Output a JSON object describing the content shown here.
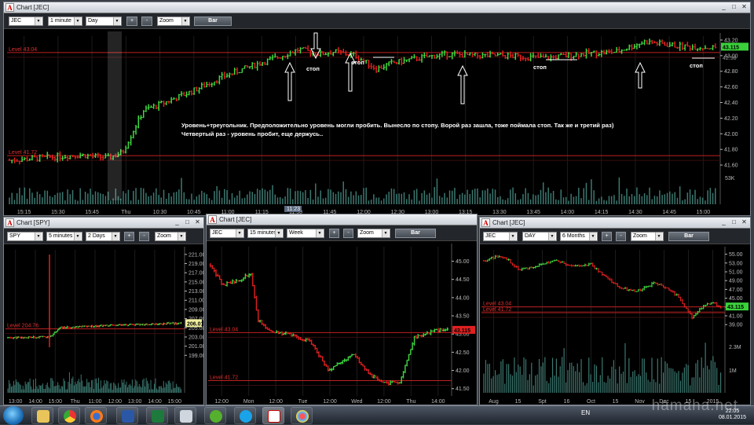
{
  "colors": {
    "up": "#40d840",
    "down": "#e02020",
    "level": "#c02020",
    "axis": "#bbbbbb",
    "volume": "#3c7870"
  },
  "main": {
    "title": "Chart [JEC]",
    "symbol": "JEC",
    "interval": "1 minute",
    "period": "Day",
    "zoom": "Zoom",
    "bar": "Bar",
    "plus": "+",
    "minus": "-",
    "level_top": "Level 43.04",
    "level_bottom": "Level 41.72",
    "last_price": "43.115",
    "ref_price": "42.98",
    "volume_label": "53K",
    "cursor_time": "11:23",
    "annotation_line1": "Уровень+треугольник. Предположительно уровень могли пробить. Вынесло по стопу. Ворой раз зашла, тоже поймала стоп. Так же и третий раз)",
    "annotation_line2": "Четвертый раз - уровень пробит, еще держусь..",
    "stop_label": "стоп"
  },
  "spy": {
    "title": "Chart [SPY]",
    "symbol": "SPY",
    "interval": "5 minutes",
    "period": "2 Days",
    "zoom": "Zoom",
    "bar": "Bar",
    "plus": "+",
    "minus": "-",
    "level": "Level 204.76",
    "last_price": "206.01"
  },
  "jec15": {
    "title": "Chart [JEC]",
    "symbol": "JEC",
    "interval": "15 minutes",
    "period": "Week",
    "zoom": "Zoom",
    "bar": "Bar",
    "plus": "+",
    "minus": "-",
    "level_top": "Level 43.04",
    "level_bottom": "Level 41.72",
    "last_price": "43.115"
  },
  "jecday": {
    "title": "Chart [JEC]",
    "symbol": "JEC",
    "interval": "DAY",
    "period": "6 Months",
    "zoom": "Zoom",
    "bar": "Bar",
    "plus": "+",
    "minus": "-",
    "level_top": "Level 43.04",
    "level_bottom": "Level 41.72",
    "last_price": "43.115"
  },
  "taskbar": {
    "lang": "EN",
    "time": "22:05",
    "date": "08.01.2015"
  },
  "watermark": "hamaha.net",
  "chart_data": [
    {
      "name": "JEC 1 minute",
      "type": "bar",
      "y_ticks": [
        43.2,
        43.0,
        42.8,
        42.6,
        42.4,
        42.2,
        42.0,
        41.8,
        41.6
      ],
      "ylim": [
        41.5,
        43.25
      ],
      "x_labels": [
        "15:15",
        "15:30",
        "15:45",
        "Thu",
        "10:30",
        "10:45",
        "11:00",
        "11:15",
        "11:30",
        "11:45",
        "12:00",
        "12:30",
        "13:00",
        "13:15",
        "13:30",
        "13:45",
        "14:00",
        "14:15",
        "14:30",
        "14:45",
        "15:00"
      ],
      "levels": [
        43.04,
        41.72
      ],
      "anchors": [
        [
          0,
          41.66
        ],
        [
          0.1,
          41.73
        ],
        [
          0.14,
          41.69
        ],
        [
          0.16,
          41.76
        ],
        [
          0.19,
          42.3
        ],
        [
          0.22,
          42.4
        ],
        [
          0.26,
          42.55
        ],
        [
          0.3,
          42.72
        ],
        [
          0.34,
          42.86
        ],
        [
          0.38,
          42.98
        ],
        [
          0.41,
          43.08
        ],
        [
          0.44,
          43.02
        ],
        [
          0.46,
          43.05
        ],
        [
          0.49,
          43.0
        ],
        [
          0.52,
          42.83
        ],
        [
          0.54,
          42.9
        ],
        [
          0.58,
          42.97
        ],
        [
          0.62,
          43.02
        ],
        [
          0.66,
          43.0
        ],
        [
          0.7,
          43.0
        ],
        [
          0.76,
          42.97
        ],
        [
          0.82,
          43.03
        ],
        [
          0.86,
          43.05
        ],
        [
          0.9,
          43.18
        ],
        [
          0.95,
          43.12
        ],
        [
          1,
          43.1
        ]
      ]
    },
    {
      "name": "SPY 5 minutes",
      "type": "bar",
      "y_ticks": [
        221.0,
        219.0,
        217.0,
        215.0,
        213.0,
        211.0,
        209.0,
        207.0,
        205.0,
        203.0,
        201.0,
        199.0
      ],
      "ylim": [
        197,
        222
      ],
      "x_labels": [
        "13:00",
        "14:00",
        "15:00",
        "Thu",
        "11:00",
        "12:00",
        "13:00",
        "14:00",
        "15:00"
      ],
      "levels": [
        204.76
      ],
      "anchors": [
        [
          0,
          202.8
        ],
        [
          0.22,
          203.0
        ],
        [
          0.24,
          202.9
        ],
        [
          0.3,
          205.0
        ],
        [
          0.5,
          205.4
        ],
        [
          0.7,
          205.6
        ],
        [
          0.9,
          205.9
        ],
        [
          1,
          206.0
        ]
      ]
    },
    {
      "name": "JEC 15 minutes",
      "type": "bar",
      "y_ticks": [
        45.0,
        44.5,
        44.0,
        43.5,
        43.0,
        42.5,
        42.0,
        41.5
      ],
      "ylim": [
        41.3,
        45.4
      ],
      "x_labels": [
        "12:00",
        "Mon",
        "12:00",
        "Tue",
        "12:00",
        "Wed",
        "12:00",
        "Thu",
        "14:00"
      ],
      "levels": [
        43.04,
        41.72
      ],
      "anchors": [
        [
          0,
          44.9
        ],
        [
          0.05,
          44.35
        ],
        [
          0.13,
          44.5
        ],
        [
          0.17,
          44.7
        ],
        [
          0.2,
          43.4
        ],
        [
          0.25,
          43.1
        ],
        [
          0.33,
          43.0
        ],
        [
          0.42,
          42.8
        ],
        [
          0.5,
          42.0
        ],
        [
          0.6,
          42.45
        ],
        [
          0.68,
          41.85
        ],
        [
          0.74,
          41.65
        ],
        [
          0.8,
          41.7
        ],
        [
          0.86,
          42.9
        ],
        [
          0.95,
          43.1
        ],
        [
          1,
          43.15
        ]
      ]
    },
    {
      "name": "JEC DAY",
      "type": "bar",
      "y_ticks": [
        55.0,
        53.0,
        51.0,
        49.0,
        47.0,
        45.0,
        43.0,
        41.0,
        39.0
      ],
      "ylim": [
        38.5,
        56
      ],
      "x_labels": [
        "Aug",
        "15",
        "Spt",
        "16",
        "Oct",
        "15",
        "Nov",
        "Dec",
        "15",
        "2015"
      ],
      "levels": [
        43.04,
        41.72
      ],
      "volume_ticks": [
        "2.3M",
        "1M"
      ],
      "anchors": [
        [
          0,
          53.5
        ],
        [
          0.05,
          54.5
        ],
        [
          0.1,
          53.8
        ],
        [
          0.15,
          51.5
        ],
        [
          0.22,
          52.3
        ],
        [
          0.3,
          53.6
        ],
        [
          0.38,
          52.2
        ],
        [
          0.45,
          52.8
        ],
        [
          0.52,
          49.5
        ],
        [
          0.58,
          47.3
        ],
        [
          0.64,
          46.5
        ],
        [
          0.72,
          48.4
        ],
        [
          0.78,
          47.2
        ],
        [
          0.82,
          45.3
        ],
        [
          0.88,
          40.5
        ],
        [
          0.93,
          43.5
        ],
        [
          0.97,
          44.0
        ],
        [
          1,
          42.8
        ]
      ]
    }
  ]
}
